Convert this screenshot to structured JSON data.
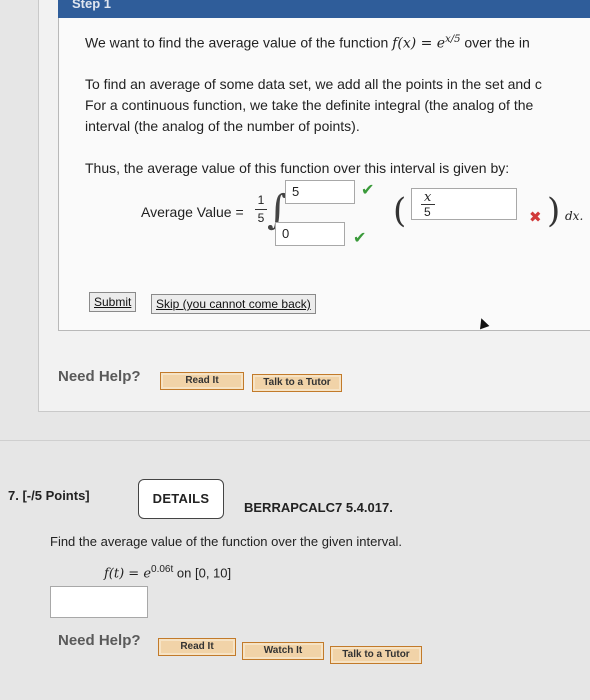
{
  "step": {
    "label": "Step 1"
  },
  "intro": {
    "line1_pre": "We want to find the average value of the function ",
    "fx": "f(x) = e",
    "fx_exp": "x/5",
    "line1_post": " over the in",
    "para2_line1": "To find an average of some data set, we add all the points in the set and c",
    "para2_line2": "For a continuous function, we take the definite integral (the analog of the",
    "para2_line3": "interval (the analog of the number of points).",
    "thus": "Thus, the average value of this function over this interval is given by:"
  },
  "formula": {
    "label": "Average Value =",
    "frac_num": "1",
    "frac_den": "5",
    "upper_limit": "5",
    "lower_limit": "0",
    "integrand_num": "x",
    "integrand_den": "5",
    "dx": "dx."
  },
  "step_buttons": {
    "submit": "Submit",
    "skip": "Skip (you cannot come back)"
  },
  "help1": {
    "label": "Need Help?",
    "read": "Read It",
    "tutor": "Talk to a Tutor"
  },
  "question7": {
    "number": "7.",
    "points": "[-/5 Points]",
    "details": "DETAILS",
    "code": "BERRAPCALC7 5.4.017.",
    "prompt": "Find the average value of the function over the given interval.",
    "ft": "f(t) = e",
    "ft_exp": "0.06t",
    "interval": "on [0, 10]"
  },
  "help2": {
    "label": "Need Help?",
    "read": "Read It",
    "watch": "Watch It",
    "tutor": "Talk to a Tutor"
  }
}
